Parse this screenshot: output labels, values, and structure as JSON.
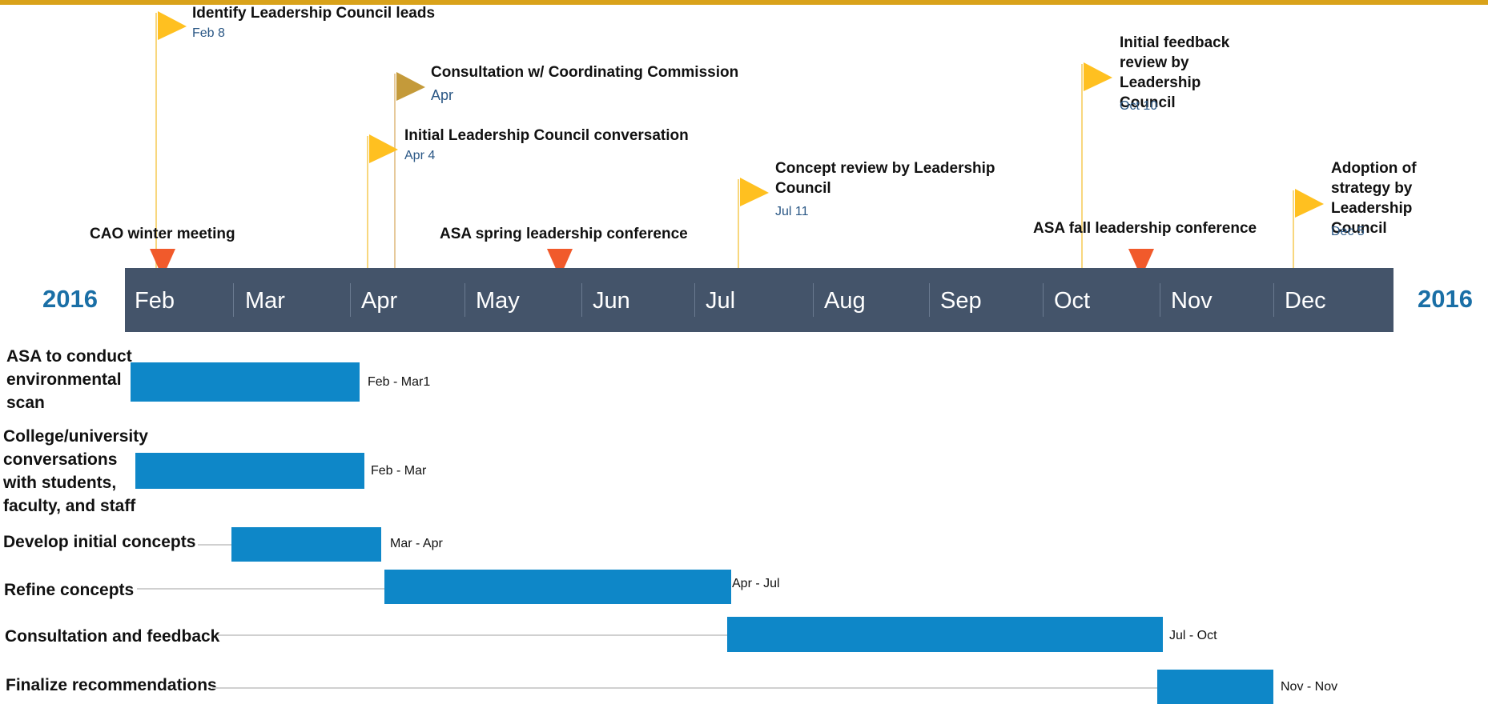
{
  "colors": {
    "accent_top": "#d9a21a",
    "band": "#44546a",
    "bar": "#0e87c8",
    "flag": "#ffc020",
    "flag_muted": "#c49a3a",
    "event_marker": "#f15a2b",
    "year": "#1a6fa6",
    "date": "#2a5785"
  },
  "timeline": {
    "year_start": "2016",
    "year_end": "2016",
    "months": [
      "Feb",
      "Mar",
      "Apr",
      "May",
      "Jun",
      "Jul",
      "Aug",
      "Sep",
      "Oct",
      "Nov",
      "Dec"
    ]
  },
  "milestones": [
    {
      "title": "Identify Leadership Council leads",
      "date": "Feb 8",
      "icon": "flag-icon"
    },
    {
      "title": "Consultation w/ Coordinating Commission",
      "date": "Apr",
      "icon": "flag-icon"
    },
    {
      "title": "Initial Leadership Council conversation",
      "date": "Apr 4",
      "icon": "flag-icon"
    },
    {
      "title": "Concept review by Leadership Council",
      "date": "Jul 11",
      "icon": "flag-icon"
    },
    {
      "title": "Initial feedback review by Leadership Council",
      "date": "Oct 10",
      "icon": "flag-icon"
    },
    {
      "title": "Adoption of strategy by Leadership Council",
      "date": "Dec 5",
      "icon": "flag-icon"
    }
  ],
  "events": [
    {
      "label": "CAO winter meeting",
      "icon": "triangle-down-icon"
    },
    {
      "label": "ASA spring leadership conference",
      "icon": "triangle-down-icon"
    },
    {
      "label": "ASA fall leadership conference",
      "icon": "triangle-down-icon"
    }
  ],
  "tasks": [
    {
      "label": "ASA to conduct environmental scan",
      "range": "Feb  - Mar1"
    },
    {
      "label": "College/university conversations with students, faculty, and staff",
      "range": "Feb  - Mar"
    },
    {
      "label": "Develop initial concepts",
      "range": "Mar - Apr"
    },
    {
      "label": "Refine concepts",
      "range": "Apr - Jul"
    },
    {
      "label": "Consultation and feedback",
      "range": "Jul - Oct"
    },
    {
      "label": "Finalize recommendations",
      "range": "Nov - Nov"
    }
  ]
}
